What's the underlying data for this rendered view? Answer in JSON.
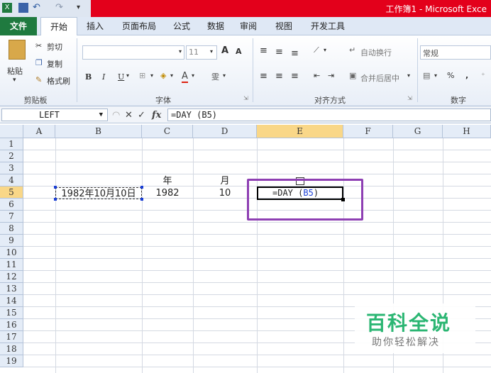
{
  "window": {
    "title": "工作簿1 - Microsoft Exce"
  },
  "tabs": [
    "文件",
    "开始",
    "插入",
    "页面布局",
    "公式",
    "数据",
    "审阅",
    "视图",
    "开发工具"
  ],
  "clipboard": {
    "paste": "粘贴",
    "cut": "剪切",
    "copy": "复制",
    "format_painter": "格式刷",
    "label": "剪贴板"
  },
  "font": {
    "size": "11",
    "grow": "A",
    "shrink": "A",
    "bold": "B",
    "italic": "I",
    "underline": "U",
    "font_color": "A",
    "phonetic": "雯",
    "label": "字体"
  },
  "alignment": {
    "wrap": "自动换行",
    "merge": "合并后居中",
    "label": "对齐方式"
  },
  "number": {
    "format": "常规",
    "percent": "%",
    "comma": ",",
    "label": "数字"
  },
  "formula_bar": {
    "name_box": "LEFT",
    "cancel": "✕",
    "enter": "✓",
    "fx": "fx",
    "formula": "=DAY (B5)"
  },
  "columns": [
    "A",
    "B",
    "C",
    "D",
    "E",
    "F",
    "G",
    "H"
  ],
  "rows": [
    "1",
    "2",
    "3",
    "4",
    "5",
    "6",
    "7",
    "8",
    "9",
    "10",
    "11",
    "12",
    "13",
    "14",
    "15",
    "16",
    "17",
    "18",
    "19"
  ],
  "cells": {
    "C4": "年",
    "D4": "月",
    "B5": "1982年10月10日",
    "C5": "1982",
    "D5": "10",
    "E5_prefix": "=DAY (",
    "E5_ref": "B5",
    "E5_suffix": ")"
  },
  "colors": {
    "highlight_box": "#8e3fb3",
    "ref_blue": "#1a3fd6",
    "selected_header": "#f9d788"
  },
  "watermark": {
    "title": "百科全说",
    "subtitle": "助你轻松解决"
  }
}
